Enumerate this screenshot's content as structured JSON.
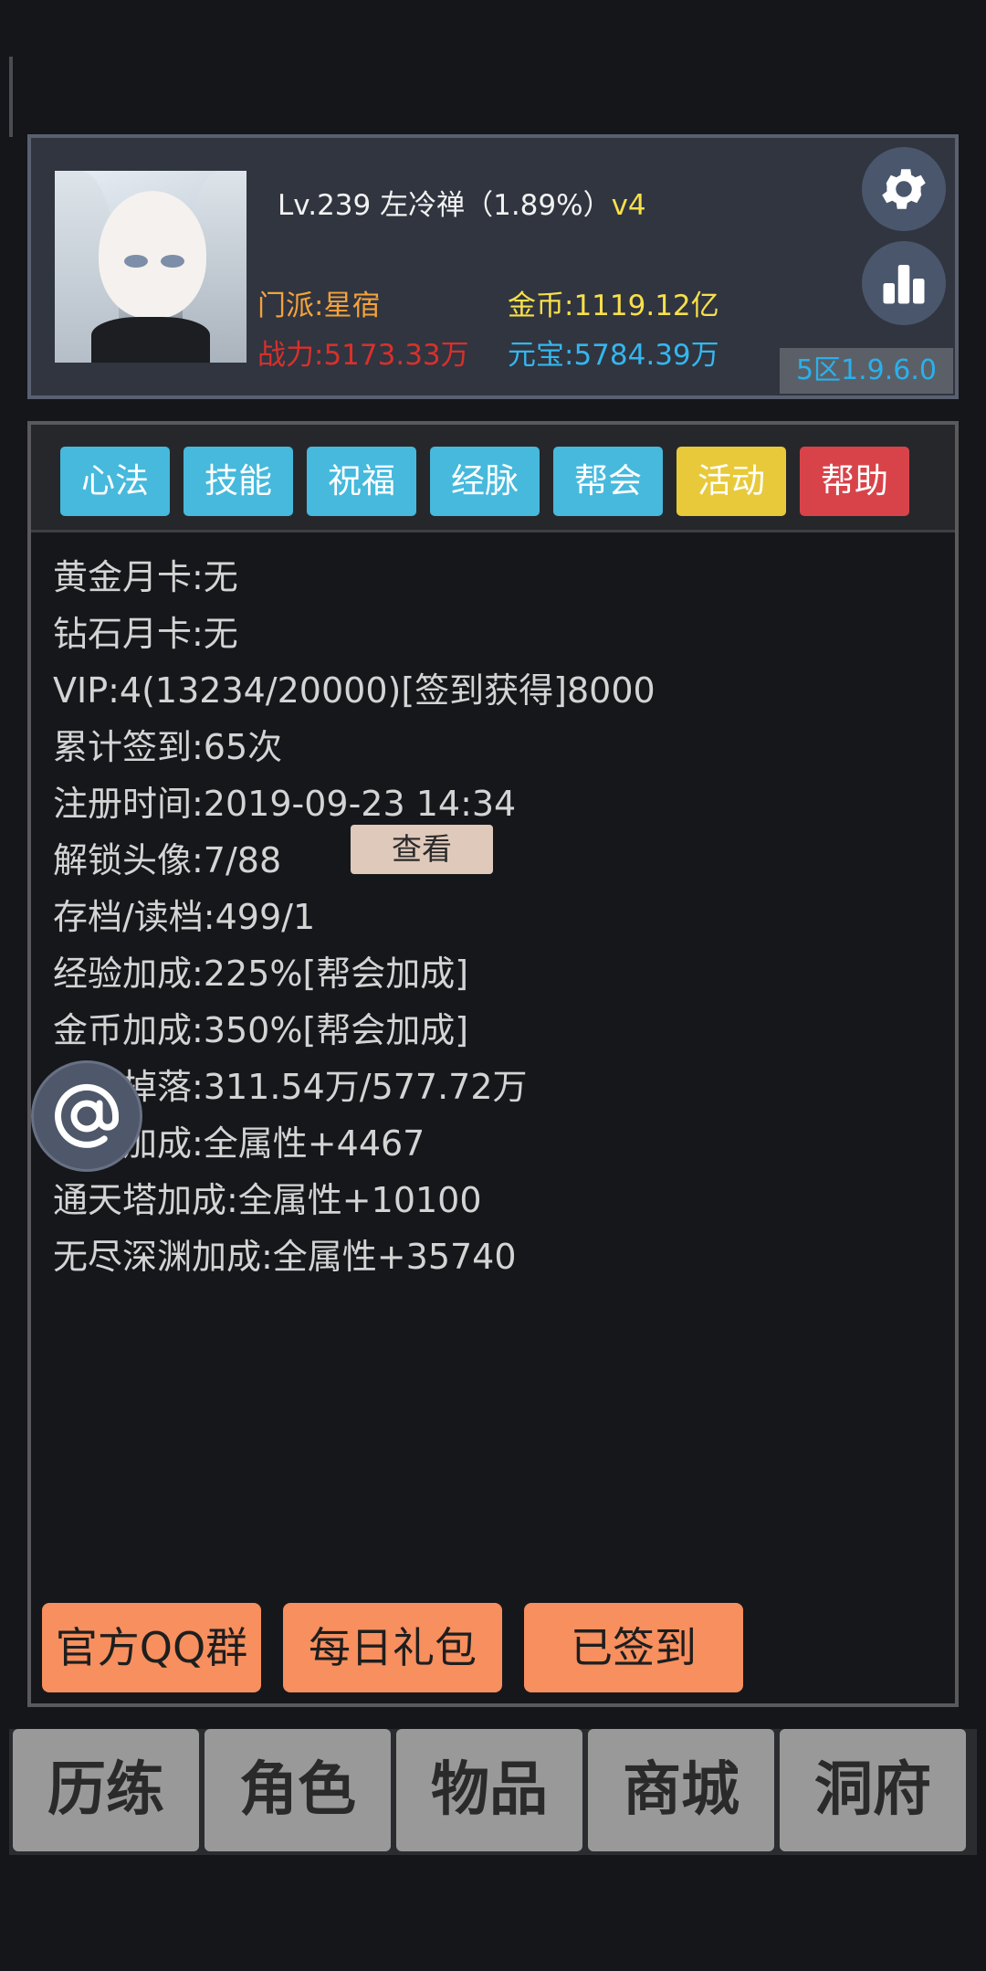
{
  "header": {
    "level": "Lv.239",
    "name": "左冷禅",
    "exp_percent": "（1.89%）",
    "vip_tag": "v4",
    "sect": "门派:星宿",
    "gold": "金币:1119.12亿",
    "power": "战力:5173.33万",
    "yuanbao": "元宝:5784.39万",
    "server_version": "5区1.9.6.0"
  },
  "tabs": [
    {
      "label": "心法"
    },
    {
      "label": "技能"
    },
    {
      "label": "祝福"
    },
    {
      "label": "经脉"
    },
    {
      "label": "帮会"
    },
    {
      "label": "活动"
    },
    {
      "label": "帮助"
    }
  ],
  "info": {
    "gold_card": "黄金月卡:无",
    "diamond_card": "钻石月卡:无",
    "vip": "VIP:4(13234/20000)[签到获得]8000",
    "checkin": "累计签到:65次",
    "register_time": "注册时间:2019-09-23 14:34",
    "avatars": "解锁头像:7/88",
    "view_button": "查看",
    "saves": "存档/读档:499/1",
    "exp_bonus": "经验加成:225%[帮会加成]",
    "gold_bonus": "金币加成:350%[帮会加成]",
    "drop": "物品掉落:311.54万/577.72万",
    "jade_bonus": "灵玉加成:全属性+4467",
    "tower_bonus": "通天塔加成:全属性+10100",
    "abyss_bonus": "无尽深渊加成:全属性+35740"
  },
  "actions": {
    "qq_group": "官方QQ群",
    "daily_gift": "每日礼包",
    "signed": "已签到"
  },
  "nav": [
    {
      "label": "历练"
    },
    {
      "label": "角色"
    },
    {
      "label": "物品"
    },
    {
      "label": "商城"
    },
    {
      "label": "洞府"
    }
  ],
  "icons": {
    "settings": "gear-icon",
    "rank": "bar-chart-icon",
    "floating": "at-sign-icon"
  },
  "colors": {
    "tab_blue": "#46b9dd",
    "tab_yellow": "#e8c93a",
    "tab_red": "#d8434a",
    "action_orange": "#f78f5e"
  }
}
